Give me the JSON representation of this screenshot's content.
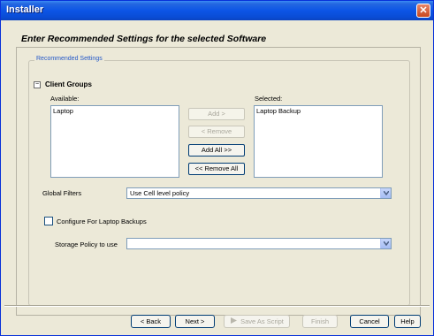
{
  "window": {
    "title": "Installer",
    "close_glyph": "✕"
  },
  "page": {
    "heading": "Enter Recommended Settings for the selected Software"
  },
  "settings_group": {
    "legend": "Recommended Settings"
  },
  "client_groups": {
    "collapse_glyph": "−",
    "title": "Client Groups",
    "available_label": "Available:",
    "selected_label": "Selected:",
    "available_items": [
      "Laptop"
    ],
    "selected_items": [
      "Laptop Backup"
    ],
    "add_label": "Add >",
    "remove_label": "< Remove",
    "add_all_label": "Add All >>",
    "remove_all_label": "<< Remove All"
  },
  "global_filters": {
    "label": "Global Filters",
    "value": "Use Cell level policy"
  },
  "laptop_backups": {
    "checkbox_label": "Configure For Laptop Backups",
    "checked": false
  },
  "storage_policy": {
    "label": "Storage Policy to use",
    "value": ""
  },
  "footer": {
    "back_label": "< Back",
    "next_label": "Next >",
    "save_script_label": "Save As Script",
    "finish_label": "Finish",
    "cancel_label": "Cancel",
    "help_label": "Help"
  },
  "icons": {
    "close": "close-icon",
    "dropdown": "chevron-down-icon",
    "script": "script-arrow-icon"
  },
  "colors": {
    "titlebar": "#0c55e6",
    "legend": "#2458c8",
    "window_bg": "#ece9d8"
  }
}
